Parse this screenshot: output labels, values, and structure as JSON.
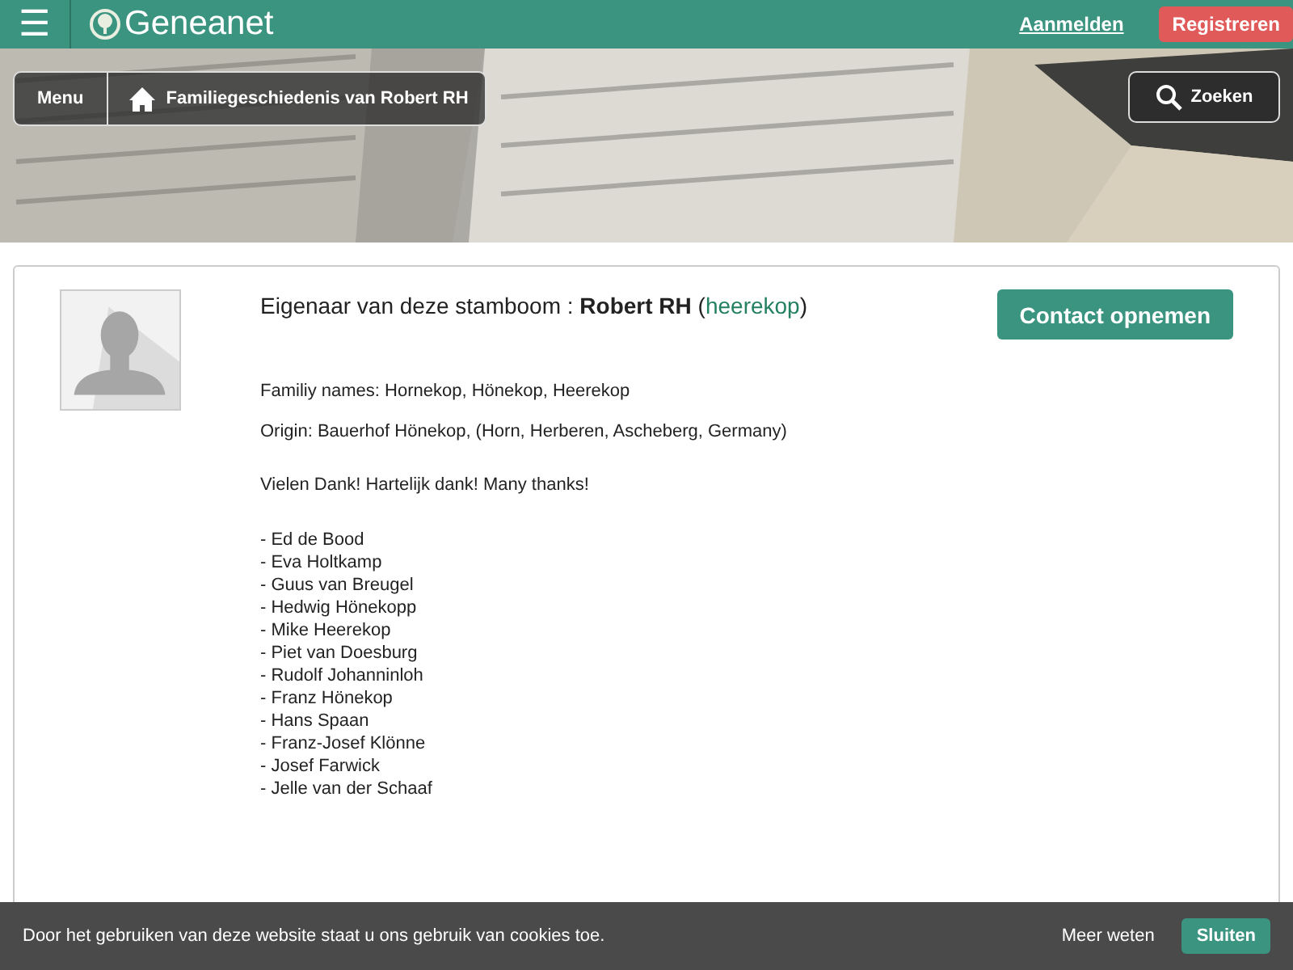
{
  "header": {
    "menu_icon": "☰",
    "logo": "Geneanet",
    "login": "Aanmelden",
    "register": "Registreren"
  },
  "banner": {
    "kind": "picture",
    "menu": "Menu",
    "breadcrumb": "Familiegeschiedenis van Robert RH",
    "search": "Zoeken"
  },
  "owner": {
    "label": "Eigenaar van deze stamboom : ",
    "name": "Robert RH",
    "bracket_open": "(",
    "username": "heerekop",
    "bracket_close": ")",
    "contact": "Contact opnemen"
  },
  "lines": [
    "Familiy names: Hornekop, Hönekop, Heerekop",
    "Origin: Bauerhof Hönekop, (Horn, Herberen, Ascheberg, Germany)"
  ],
  "thanks": "Vielen Dank! Hartelijk dank! Many thanks!",
  "names": [
    "- Ed de Bood",
    "- Eva Holtkamp",
    "- Guus van Breugel",
    "- Hedwig Hönekopp",
    "- Mike Heerekop",
    "- Piet van Doesburg",
    "- Rudolf Johanninloh",
    "- Franz Hönekop",
    "- Hans Spaan",
    "- Franz-Josef Klönne",
    "- Josef Farwick",
    "- Jelle van der Schaaf"
  ],
  "cookie_bar": {
    "message": "Door het gebruiken van deze website staat u ons gebruik van cookies toe.",
    "more": "Meer weten",
    "close": "Sluiten"
  }
}
